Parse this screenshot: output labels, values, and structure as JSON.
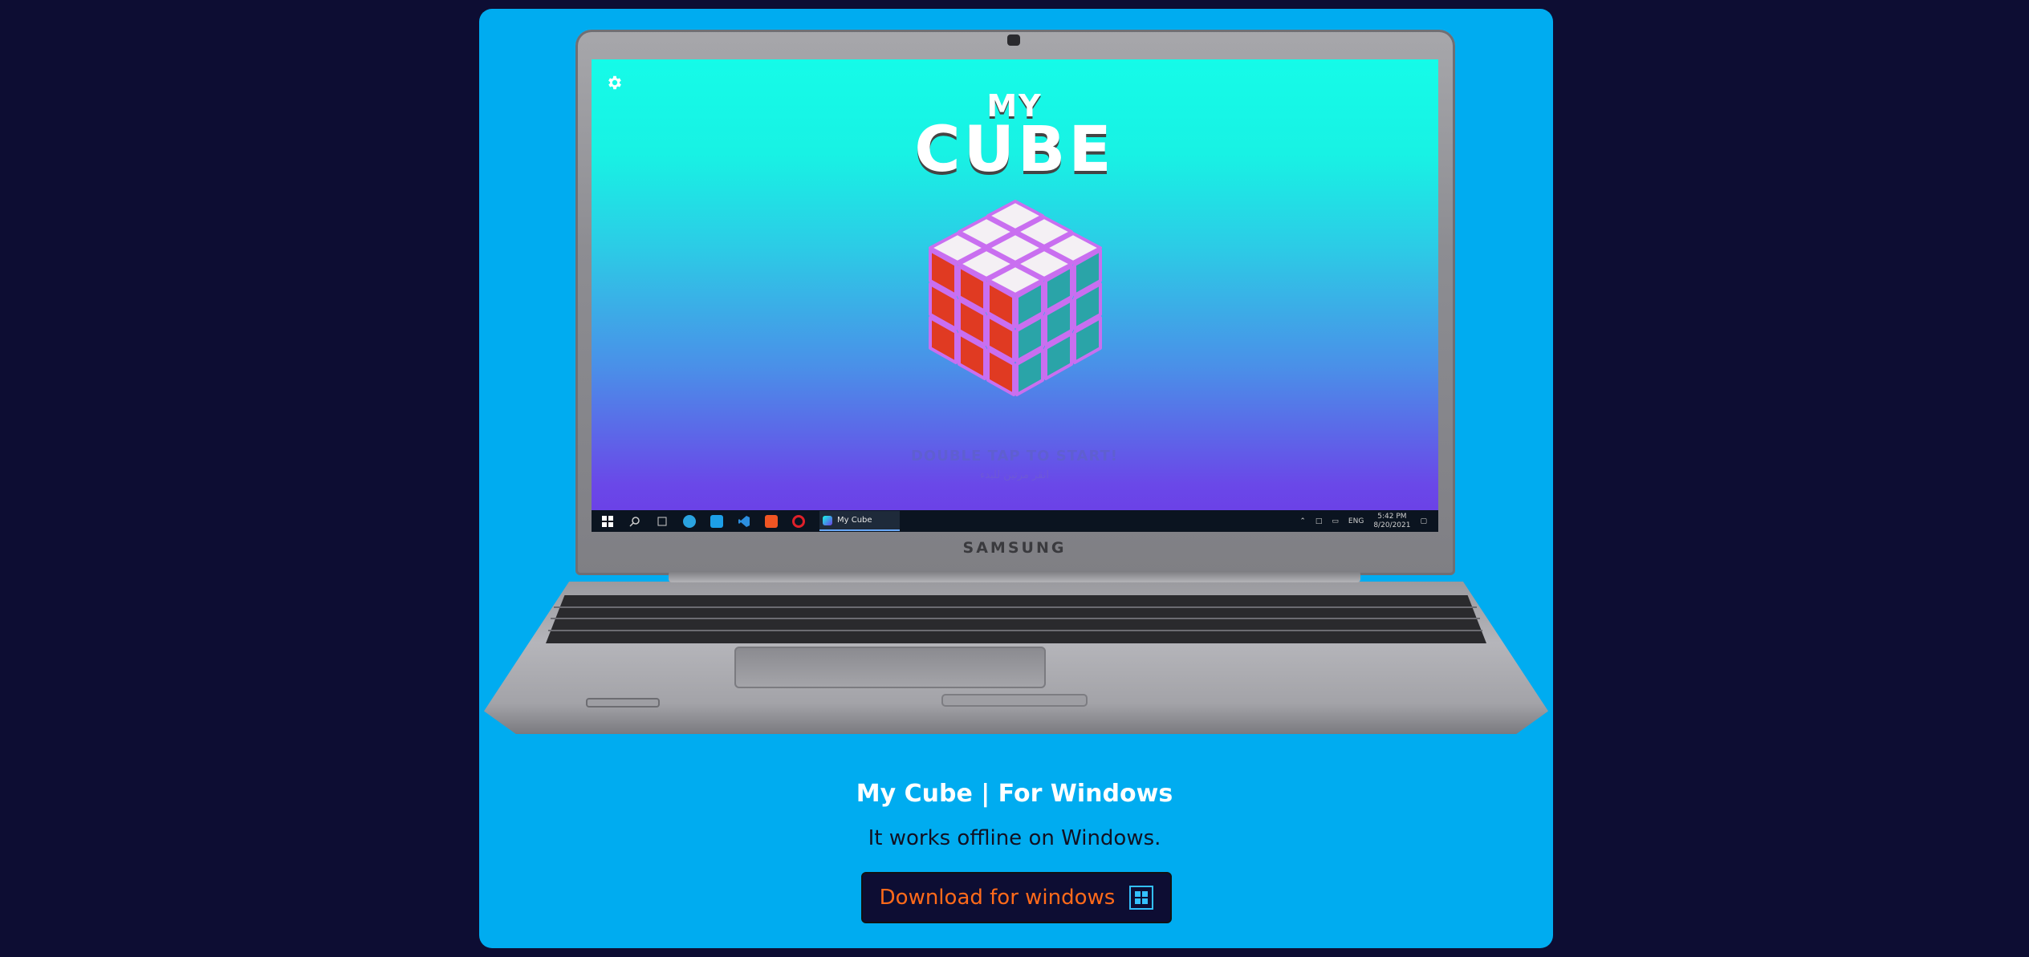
{
  "laptop": {
    "brand": "SAMSUNG",
    "screen": {
      "settings_icon": "gear-icon",
      "title_line1": "MY",
      "title_line2": "CUBE",
      "start_hint": "DOUBLE TAP TO START!",
      "start_hint_ar": "انقر مرتين للبدء",
      "cube_colors": {
        "top": "#f4f0f4",
        "left": "#e03a22",
        "right": "#2aa4a8",
        "edge": "#c96ff0"
      },
      "taskbar": {
        "icons": [
          "windows-start-icon",
          "search-icon",
          "task-view-icon",
          "telegram-icon",
          "app-icon",
          "vscode-icon",
          "brave-icon",
          "opera-icon"
        ],
        "active_app": "My Cube",
        "tray": {
          "language": "ENG",
          "time": "5:42 PM",
          "date": "8/20/2021"
        }
      }
    }
  },
  "section": {
    "heading": "My Cube | For Windows",
    "description": "It works offline on Windows.",
    "download_button": {
      "label": "Download for windows",
      "icon": "windows-icon"
    }
  },
  "colors": {
    "page_bg": "#0d0d33",
    "card_bg": "#00acf0",
    "button_text": "#ff6a1a",
    "button_icon": "#33c0ff"
  }
}
